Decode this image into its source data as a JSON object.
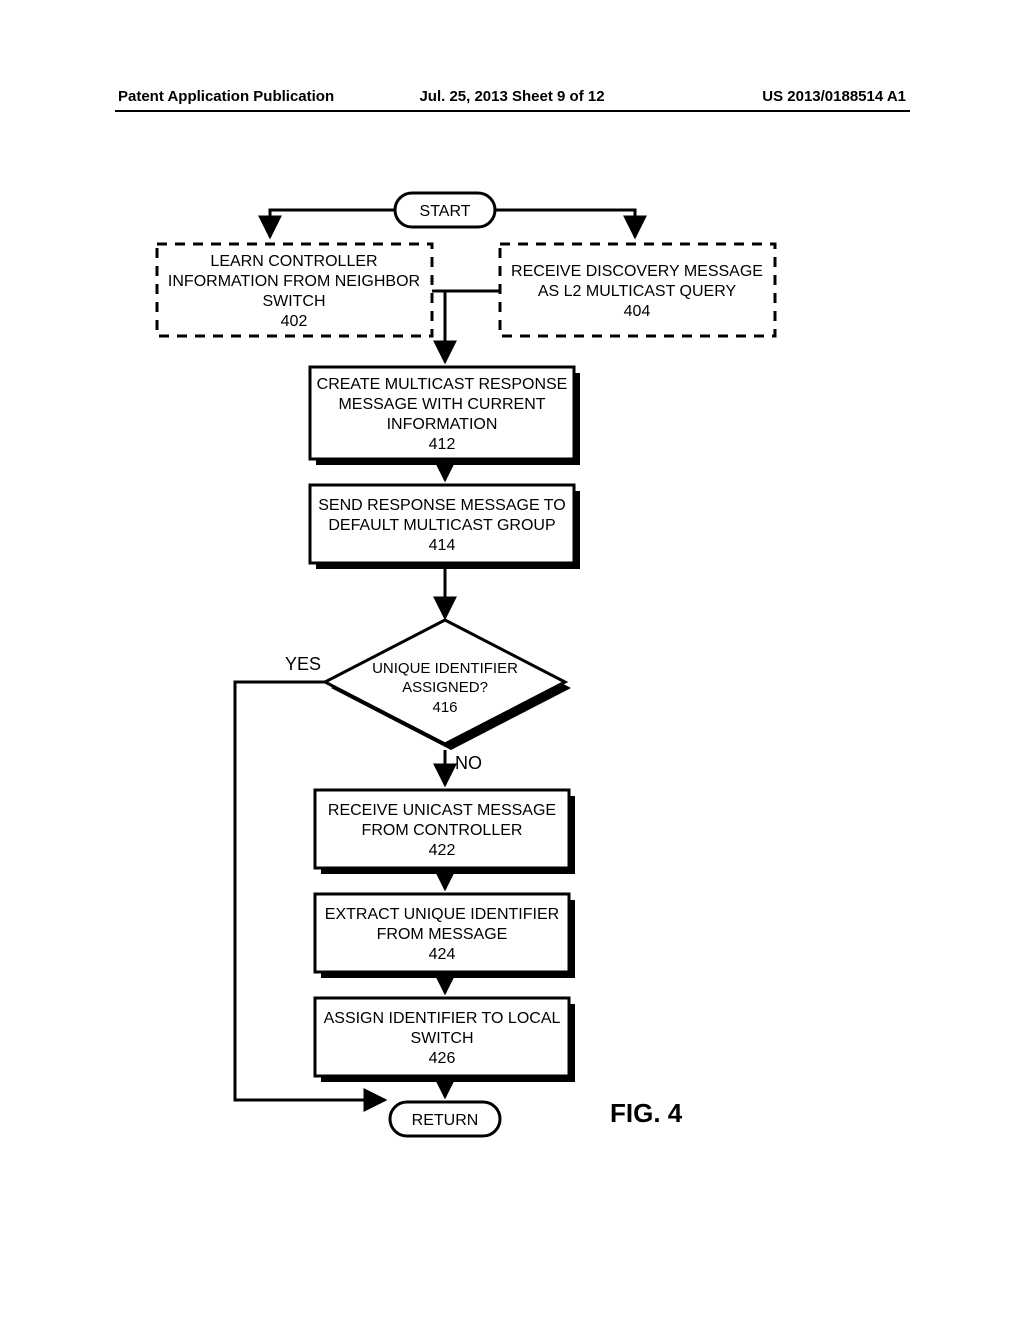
{
  "header": {
    "left": "Patent Application Publication",
    "center": "Jul. 25, 2013   Sheet 9 of 12",
    "right": "US 2013/0188514 A1"
  },
  "figure_label": "FIG. 4",
  "decision_labels": {
    "yes": "YES",
    "no": "NO"
  },
  "nodes": {
    "start": {
      "text": "START"
    },
    "n402": {
      "line1": "LEARN CONTROLLER",
      "line2": "INFORMATION FROM NEIGHBOR",
      "line3": "SWITCH",
      "ref": "402"
    },
    "n404": {
      "line1": "RECEIVE DISCOVERY MESSAGE",
      "line2": "AS L2 MULTICAST QUERY",
      "ref": "404"
    },
    "n412": {
      "line1": "CREATE MULTICAST RESPONSE",
      "line2": "MESSAGE WITH CURRENT",
      "line3": "INFORMATION",
      "ref": "412"
    },
    "n414": {
      "line1": "SEND RESPONSE MESSAGE TO",
      "line2": "DEFAULT MULTICAST GROUP",
      "ref": "414"
    },
    "n416": {
      "line1": "UNIQUE IDENTIFIER",
      "line2": "ASSIGNED?",
      "ref": "416"
    },
    "n422": {
      "line1": "RECEIVE UNICAST MESSAGE",
      "line2": "FROM CONTROLLER",
      "ref": "422"
    },
    "n424": {
      "line1": "EXTRACT UNIQUE IDENTIFIER",
      "line2": "FROM MESSAGE",
      "ref": "424"
    },
    "n426": {
      "line1": "ASSIGN IDENTIFIER TO LOCAL",
      "line2": "SWITCH",
      "ref": "426"
    },
    "return": {
      "text": "RETURN"
    }
  },
  "chart_data": {
    "type": "flowchart",
    "title": "FIG. 4",
    "nodes": [
      {
        "id": "start",
        "shape": "terminator",
        "label": "START"
      },
      {
        "id": "402",
        "shape": "process-dashed",
        "label": "LEARN CONTROLLER INFORMATION FROM NEIGHBOR SWITCH",
        "ref": "402"
      },
      {
        "id": "404",
        "shape": "process-dashed",
        "label": "RECEIVE DISCOVERY MESSAGE AS L2 MULTICAST QUERY",
        "ref": "404"
      },
      {
        "id": "412",
        "shape": "process",
        "label": "CREATE MULTICAST RESPONSE MESSAGE WITH CURRENT INFORMATION",
        "ref": "412"
      },
      {
        "id": "414",
        "shape": "process",
        "label": "SEND RESPONSE MESSAGE TO DEFAULT MULTICAST GROUP",
        "ref": "414"
      },
      {
        "id": "416",
        "shape": "decision",
        "label": "UNIQUE IDENTIFIER ASSIGNED?",
        "ref": "416"
      },
      {
        "id": "422",
        "shape": "process",
        "label": "RECEIVE UNICAST MESSAGE FROM CONTROLLER",
        "ref": "422"
      },
      {
        "id": "424",
        "shape": "process",
        "label": "EXTRACT UNIQUE IDENTIFIER FROM MESSAGE",
        "ref": "424"
      },
      {
        "id": "426",
        "shape": "process",
        "label": "ASSIGN IDENTIFIER TO LOCAL SWITCH",
        "ref": "426"
      },
      {
        "id": "return",
        "shape": "terminator",
        "label": "RETURN"
      }
    ],
    "edges": [
      {
        "from": "start",
        "to": "402"
      },
      {
        "from": "start",
        "to": "404"
      },
      {
        "from": "402",
        "to": "412"
      },
      {
        "from": "404",
        "to": "412"
      },
      {
        "from": "412",
        "to": "414"
      },
      {
        "from": "414",
        "to": "416"
      },
      {
        "from": "416",
        "to": "422",
        "label": "NO"
      },
      {
        "from": "416",
        "to": "return",
        "label": "YES"
      },
      {
        "from": "422",
        "to": "424"
      },
      {
        "from": "424",
        "to": "426"
      },
      {
        "from": "426",
        "to": "return"
      }
    ]
  }
}
